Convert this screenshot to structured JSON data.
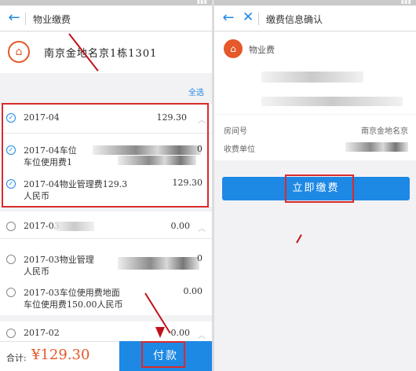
{
  "left": {
    "nav": {
      "back_icon": "back-arrow-icon",
      "title": "物业缴费"
    },
    "house": {
      "icon": "house-icon",
      "address": "南京金地名京1栋1301"
    },
    "select_all": "全选",
    "items": [
      {
        "label": "2017-04",
        "amount": "129.30",
        "checked": true
      },
      {
        "label": "2017-04车位",
        "subtitle": "车位使用费1",
        "amount": "0",
        "checked": true
      },
      {
        "label": "2017-04物业管理费129.3",
        "subtitle": "人民币",
        "amount": "129.30",
        "checked": true
      },
      {
        "label": "2017-03",
        "amount": "0.00",
        "checked": false
      },
      {
        "label": "2017-03物业管理",
        "subtitle": "人民币",
        "amount": "0",
        "checked": false
      },
      {
        "label": "2017-03车位使用费地面",
        "subtitle": "车位使用费150.00人民币",
        "amount": "0.00",
        "checked": false
      },
      {
        "label": "2017-02",
        "amount": "0.00",
        "checked": false
      }
    ],
    "bottom": {
      "total_label": "合计:",
      "total_value": "¥129.30",
      "pay_button": "付款"
    }
  },
  "right": {
    "nav": {
      "back_icon": "back-arrow-icon",
      "close_icon": "close-icon",
      "title": "缴费信息确认"
    },
    "category": {
      "icon": "house-icon",
      "label": "物业费"
    },
    "info": {
      "house_label": "房间号",
      "house_value": "南京金地名京",
      "payee_label": "收费单位"
    },
    "confirm_button": "立即缴费"
  },
  "colors": {
    "accent": "#1e88e5",
    "price": "#e4582a",
    "annotation": "#d92b2b"
  }
}
